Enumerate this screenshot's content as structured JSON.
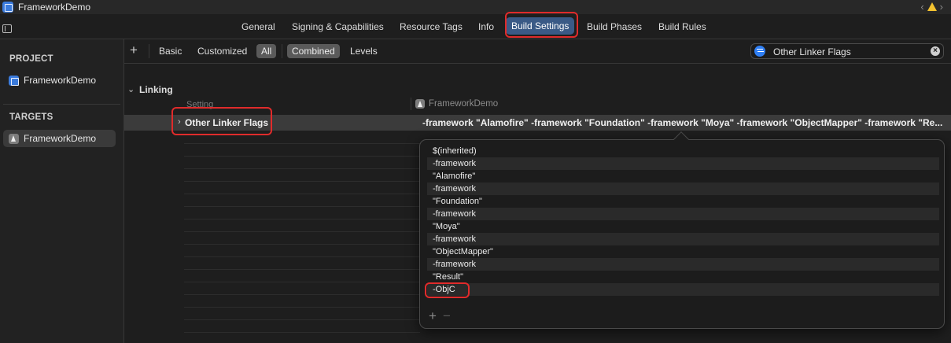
{
  "window": {
    "title": "FrameworkDemo"
  },
  "tabs": [
    {
      "label": "General"
    },
    {
      "label": "Signing & Capabilities"
    },
    {
      "label": "Resource Tags"
    },
    {
      "label": "Info"
    },
    {
      "label": "Build Settings",
      "active": true
    },
    {
      "label": "Build Phases"
    },
    {
      "label": "Build Rules"
    }
  ],
  "sidebar": {
    "project_header": "PROJECT",
    "project_item": "FrameworkDemo",
    "targets_header": "TARGETS",
    "target_item": "FrameworkDemo"
  },
  "filters": {
    "add": "+",
    "basic": "Basic",
    "customized": "Customized",
    "all": "All",
    "combined": "Combined",
    "levels": "Levels"
  },
  "search": {
    "value": "Other Linker Flags"
  },
  "content": {
    "group": "Linking",
    "col_setting": "Setting",
    "col_target": "FrameworkDemo",
    "setting_name": "Other Linker Flags",
    "setting_value": "-framework \"Alamofire\" -framework \"Foundation\" -framework \"Moya\" -framework \"ObjectMapper\" -framework \"Re..."
  },
  "popover": {
    "rows": [
      "$(inherited)",
      "-framework",
      "\"Alamofire\"",
      "-framework",
      "\"Foundation\"",
      "-framework",
      "\"Moya\"",
      "-framework",
      "\"ObjectMapper\"",
      "-framework",
      "\"Result\"",
      "-ObjC"
    ],
    "add": "+",
    "remove": "−"
  },
  "colors": {
    "accent": "#3a5a86",
    "highlight": "#e02b2b",
    "background": "#1e1e1e"
  }
}
